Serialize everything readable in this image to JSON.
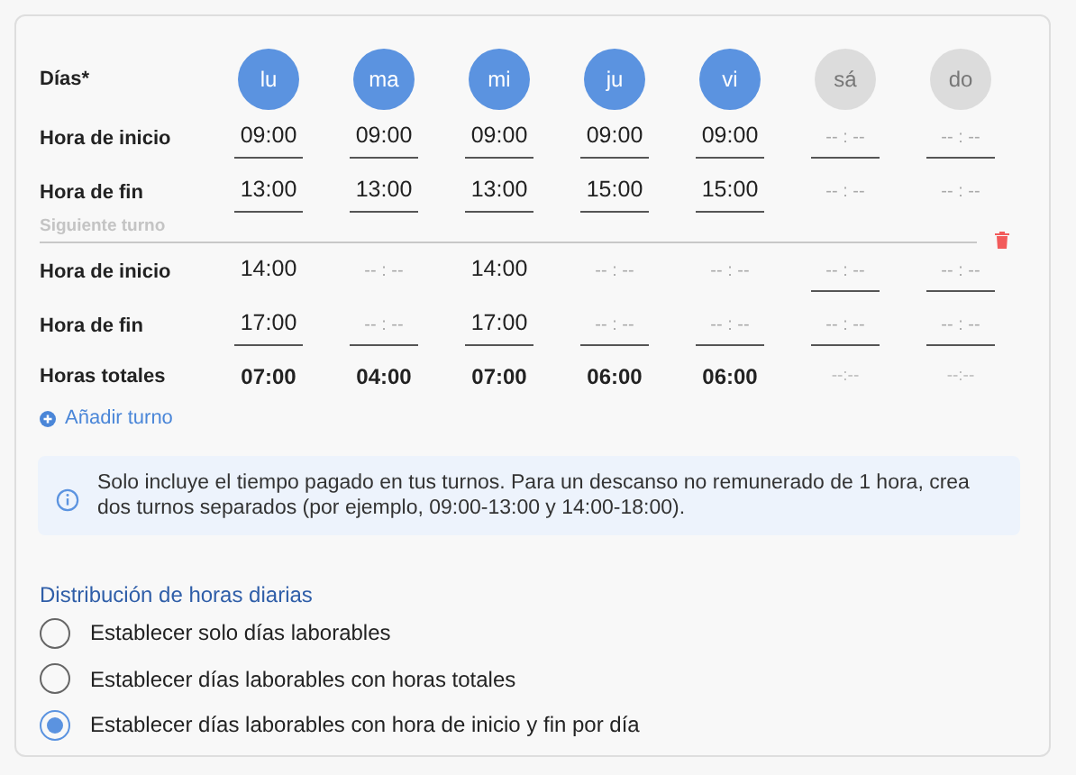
{
  "days_label": "Días*",
  "days": [
    {
      "label": "lu",
      "selected": true
    },
    {
      "label": "ma",
      "selected": true
    },
    {
      "label": "mi",
      "selected": true
    },
    {
      "label": "ju",
      "selected": true
    },
    {
      "label": "vi",
      "selected": true
    },
    {
      "label": "sá",
      "selected": false
    },
    {
      "label": "do",
      "selected": false
    }
  ],
  "shifts": [
    {
      "rows": [
        {
          "label": "Hora de inicio",
          "cells": [
            {
              "value": "09:00",
              "underlined": true
            },
            {
              "value": "09:00",
              "underlined": true
            },
            {
              "value": "09:00",
              "underlined": true
            },
            {
              "value": "09:00",
              "underlined": true
            },
            {
              "value": "09:00",
              "underlined": true
            },
            {
              "placeholder": "-- : --",
              "underlined": true
            },
            {
              "placeholder": "-- : --",
              "underlined": true
            }
          ]
        },
        {
          "label": "Hora de fin",
          "cells": [
            {
              "value": "13:00",
              "underlined": true
            },
            {
              "value": "13:00",
              "underlined": true
            },
            {
              "value": "13:00",
              "underlined": true
            },
            {
              "value": "15:00",
              "underlined": true
            },
            {
              "value": "15:00",
              "underlined": true
            },
            {
              "placeholder": "-- : --",
              "underlined": false
            },
            {
              "placeholder": "-- : --",
              "underlined": false
            }
          ]
        }
      ]
    },
    {
      "separator_label": "Siguiente turno",
      "deletable": true,
      "rows": [
        {
          "label": "Hora de inicio",
          "cells": [
            {
              "value": "14:00",
              "underlined": false
            },
            {
              "placeholder": "-- : --",
              "underlined": false
            },
            {
              "value": "14:00",
              "underlined": false
            },
            {
              "placeholder": "-- : --",
              "underlined": false
            },
            {
              "placeholder": "-- : --",
              "underlined": false
            },
            {
              "placeholder": "-- : --",
              "underlined": true
            },
            {
              "placeholder": "-- : --",
              "underlined": true
            }
          ]
        },
        {
          "label": "Hora de fin",
          "cells": [
            {
              "value": "17:00",
              "underlined": true
            },
            {
              "placeholder": "-- : --",
              "underlined": true
            },
            {
              "value": "17:00",
              "underlined": true
            },
            {
              "placeholder": "-- : --",
              "underlined": true
            },
            {
              "placeholder": "-- : --",
              "underlined": true
            },
            {
              "placeholder": "-- : --",
              "underlined": true
            },
            {
              "placeholder": "-- : --",
              "underlined": true
            }
          ]
        }
      ]
    }
  ],
  "totals": {
    "label": "Horas totales",
    "cells": [
      {
        "text": "07:00",
        "muted": false
      },
      {
        "text": "04:00",
        "muted": false
      },
      {
        "text": "07:00",
        "muted": false
      },
      {
        "text": "06:00",
        "muted": false
      },
      {
        "text": "06:00",
        "muted": false
      },
      {
        "text": "--:--",
        "muted": true
      },
      {
        "text": "--:--",
        "muted": true
      }
    ]
  },
  "add_shift": "Añadir turno",
  "info": "Solo incluye el tiempo pagado en tus turnos. Para un descanso no remunerado de 1 hora, crea dos turnos separados (por ejemplo, 09:00-13:00 y 14:00-18:00).",
  "distribution": {
    "title": "Distribución de horas diarias",
    "options": [
      {
        "label": "Establecer solo días laborables",
        "selected": false
      },
      {
        "label": "Establecer días laborables con horas totales",
        "selected": false
      },
      {
        "label": "Establecer días laborables con hora de inicio y fin por día",
        "selected": true
      }
    ]
  }
}
